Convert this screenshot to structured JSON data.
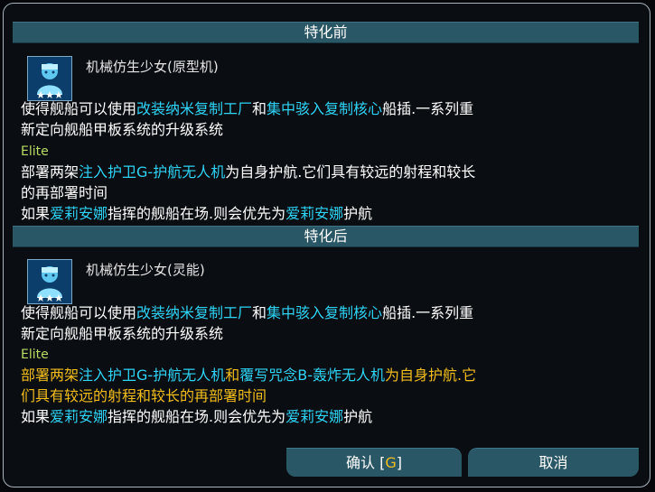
{
  "before": {
    "header": "特化前",
    "title": "机械仿生少女(原型机)",
    "desc1": [
      "使得舰船可以使用",
      "改装纳米复制工厂",
      "和",
      "集中骇入复制核心",
      "船插.一系列重"
    ],
    "desc2": "新定向舰船甲板系统的升级系统",
    "elite": "Elite",
    "elite1": [
      "部署两架",
      "注入护卫G-护航无人机",
      "为自身护航.它们具有较远的射程和较长"
    ],
    "elite2": "的再部署时间",
    "cond": [
      "如果",
      "爱莉安娜",
      "指挥的舰船在场.则会优先为",
      "爱莉安娜",
      "护航"
    ]
  },
  "after": {
    "header": "特化后",
    "title": "机械仿生少女(灵能)",
    "desc1": [
      "使得舰船可以使用",
      "改装纳米复制工厂",
      "和",
      "集中骇入复制核心",
      "船插.一系列重"
    ],
    "desc2": "新定向舰船甲板系统的升级系统",
    "elite": "Elite",
    "elite1": [
      "部署两架",
      "注入护卫G-护航无人机",
      "和",
      "覆写咒念B-轰炸无人机",
      "为自身护航.它"
    ],
    "elite2": "们具有较远的射程和较长的再部署时间",
    "cond": [
      "如果",
      "爱莉安娜",
      "指挥的舰船在场.则会优先为",
      "爱莉安娜",
      "护航"
    ]
  },
  "buttons": {
    "confirm_label": "确认",
    "confirm_hotkey_open": "[",
    "confirm_hotkey": "G",
    "confirm_hotkey_close": "]",
    "cancel_label": "取消"
  },
  "icons": {
    "portrait": "android-girl-portrait-icon",
    "stars": "rank-stars-icon"
  },
  "colors": {
    "highlight_cyan": "#2fd3f5",
    "elite_green": "#b8dc64",
    "emphasis_yellow": "#f2be1e",
    "header_bg": "#2a5766"
  }
}
